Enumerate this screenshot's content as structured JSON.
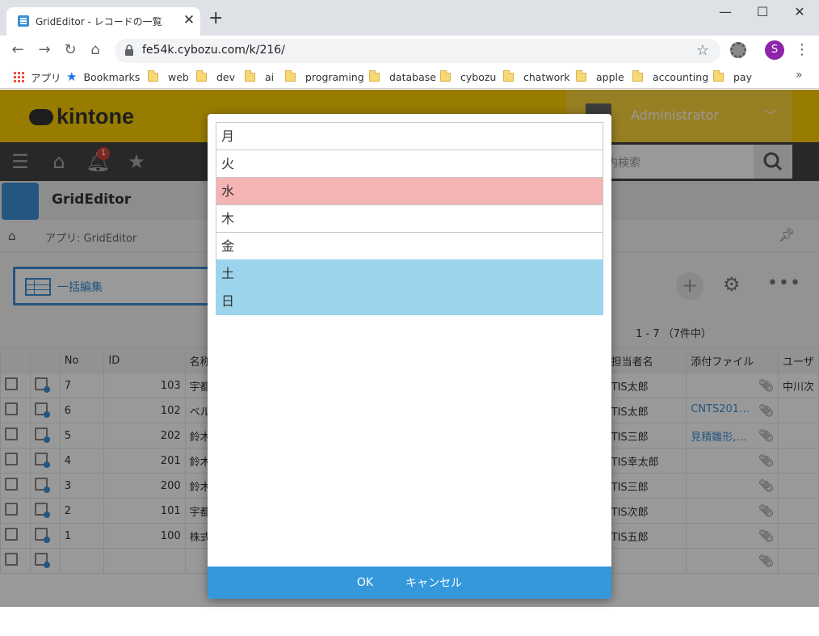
{
  "browser": {
    "tab_title": "GridEditor - レコードの一覧",
    "tab_close": "✕",
    "new_tab": "+",
    "url": "fe54k.cybozu.com/k/216/",
    "profile_initial": "S",
    "window_buttons": {
      "minimize": "—",
      "maximize": "☐",
      "close": "✕"
    },
    "nav": {
      "back": "←",
      "forward": "→",
      "reload": "↻",
      "home": "⌂"
    },
    "bookmarks": [
      {
        "label": "アプリ",
        "icon": "apps-grid-icon"
      },
      {
        "label": "Bookmarks",
        "icon": "star-icon"
      },
      {
        "label": "web",
        "icon": "folder-icon"
      },
      {
        "label": "dev",
        "icon": "folder-icon"
      },
      {
        "label": "ai",
        "icon": "folder-icon"
      },
      {
        "label": "programing",
        "icon": "folder-icon"
      },
      {
        "label": "database",
        "icon": "folder-icon"
      },
      {
        "label": "cybozu",
        "icon": "folder-icon"
      },
      {
        "label": "chatwork",
        "icon": "folder-icon"
      },
      {
        "label": "apple",
        "icon": "folder-icon"
      },
      {
        "label": "accounting",
        "icon": "folder-icon"
      },
      {
        "label": "pay",
        "icon": "folder-icon"
      }
    ],
    "bookmarks_more": "»"
  },
  "kintone": {
    "logo_text": "kintone",
    "username": "Administrator",
    "notification_count": "1",
    "search_placeholder": "内検索",
    "app_name": "GridEditor",
    "breadcrumb": "アプリ: GridEditor",
    "view_name": "一括編集",
    "record_count": "1 - 7 （7件中）",
    "table": {
      "headers": [
        "",
        "",
        "No",
        "ID",
        "名称",
        "担当者名",
        "添付ファイル",
        "ユーザ"
      ],
      "rows": [
        {
          "no": "7",
          "id": "103",
          "name": "宇都",
          "person": "TIS太郎",
          "file": "",
          "user": "中川次"
        },
        {
          "no": "6",
          "id": "102",
          "name": "ベル",
          "person": "TIS太郎",
          "file": "CNTS201…",
          "user": ""
        },
        {
          "no": "5",
          "id": "202",
          "name": "鈴木",
          "person": "TIS三郎",
          "file": "見積雛形,…",
          "user": ""
        },
        {
          "no": "4",
          "id": "201",
          "name": "鈴木",
          "person": "TIS幸太郎",
          "file": "",
          "user": ""
        },
        {
          "no": "3",
          "id": "200",
          "name": "鈴木",
          "person": "TIS三郎",
          "file": "",
          "user": ""
        },
        {
          "no": "2",
          "id": "101",
          "name": "宇都",
          "person": "TIS次郎",
          "file": "",
          "user": ""
        },
        {
          "no": "1",
          "id": "100",
          "name": "株式",
          "person": "TIS五郎",
          "file": "",
          "user": ""
        },
        {
          "no": "",
          "id": "",
          "name": "",
          "person": "",
          "file": "",
          "user": ""
        }
      ]
    }
  },
  "dialog": {
    "days": [
      {
        "label": "月",
        "style": "plain"
      },
      {
        "label": "火",
        "style": "plain"
      },
      {
        "label": "水",
        "style": "red"
      },
      {
        "label": "木",
        "style": "plain"
      },
      {
        "label": "金",
        "style": "plain"
      },
      {
        "label": "土",
        "style": "blue"
      },
      {
        "label": "日",
        "style": "blue"
      }
    ],
    "ok_label": "OK",
    "cancel_label": "キャンセル"
  },
  "colors": {
    "kintone_yellow": "#fecf00",
    "dialog_footer": "#3498db",
    "weekday_highlight_red": "#f4b4b4",
    "weekend_highlight_blue": "#9bd4ec"
  }
}
